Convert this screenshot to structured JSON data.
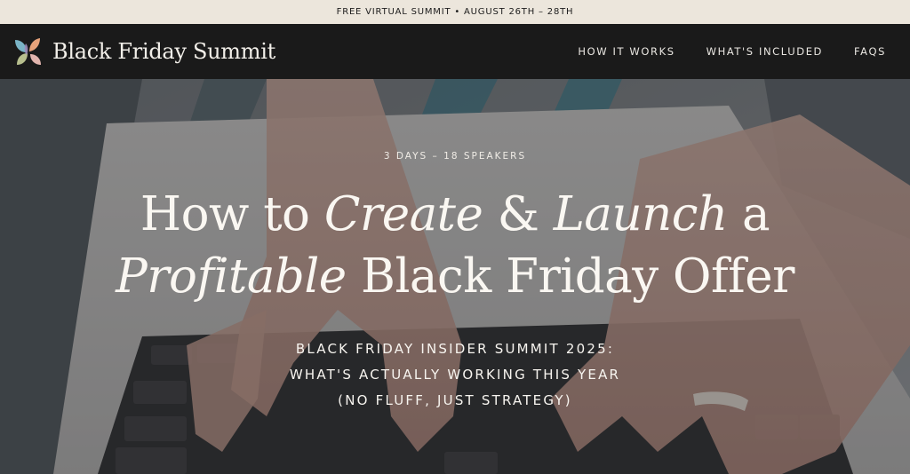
{
  "announcement": {
    "text": "FREE VIRTUAL SUMMIT • AUGUST 26TH – 28TH"
  },
  "header": {
    "brand_name": "Black Friday Summit",
    "logo_icon": "leaf-petals-logo-icon",
    "nav": [
      {
        "label": "HOW IT WORKS"
      },
      {
        "label": "WHAT'S INCLUDED"
      },
      {
        "label": "FAQS"
      }
    ]
  },
  "hero": {
    "eyebrow": "3 DAYS – 18 SPEAKERS",
    "headline": {
      "w1": "How to ",
      "w2": "Create",
      "w3": " & ",
      "w4": "Launch",
      "w5": " a",
      "w6": "Profitable",
      "w7": " Black Friday Offer"
    },
    "subhead": "BLACK FRIDAY INSIDER SUMMIT 2025: WHAT'S ACTUALLY WORKING THIS YEAR (NO FLUFF, JUST STRATEGY)"
  },
  "colors": {
    "announcement_bg": "#ece6dc",
    "nav_bg": "#1a1a1a",
    "text_light": "#f7f4ef"
  }
}
